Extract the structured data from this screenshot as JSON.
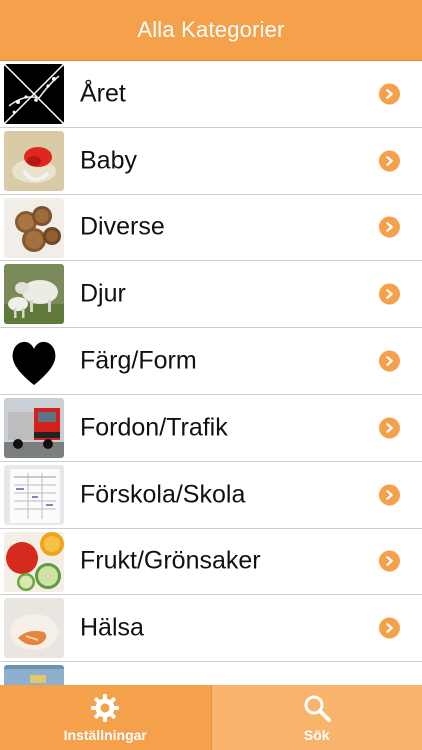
{
  "navbar": {
    "title": "Alla Kategorier"
  },
  "categories": [
    {
      "label": "Året",
      "icon": "seasons-branch-icon"
    },
    {
      "label": "Baby",
      "icon": "pacifier-icon"
    },
    {
      "label": "Diverse",
      "icon": "coins-icon"
    },
    {
      "label": "Djur",
      "icon": "sheep-icon"
    },
    {
      "label": "Färg/Form",
      "icon": "heart-icon"
    },
    {
      "label": "Fordon/Trafik",
      "icon": "truck-icon"
    },
    {
      "label": "Förskola/Skola",
      "icon": "schedule-paper-icon"
    },
    {
      "label": "Frukt/Grönsaker",
      "icon": "fruit-vegetables-icon"
    },
    {
      "label": "Hälsa",
      "icon": "bandaged-hand-icon"
    },
    {
      "label": "",
      "icon": "building-icon"
    }
  ],
  "tabs": {
    "settings": {
      "label": "Inställningar",
      "icon": "gear-icon"
    },
    "search": {
      "label": "Sök",
      "icon": "magnifier-icon"
    }
  },
  "colors": {
    "accent": "#f5a04a",
    "accent_light": "#f8b46c",
    "divider": "#cfcfcf",
    "text": "#111111"
  }
}
